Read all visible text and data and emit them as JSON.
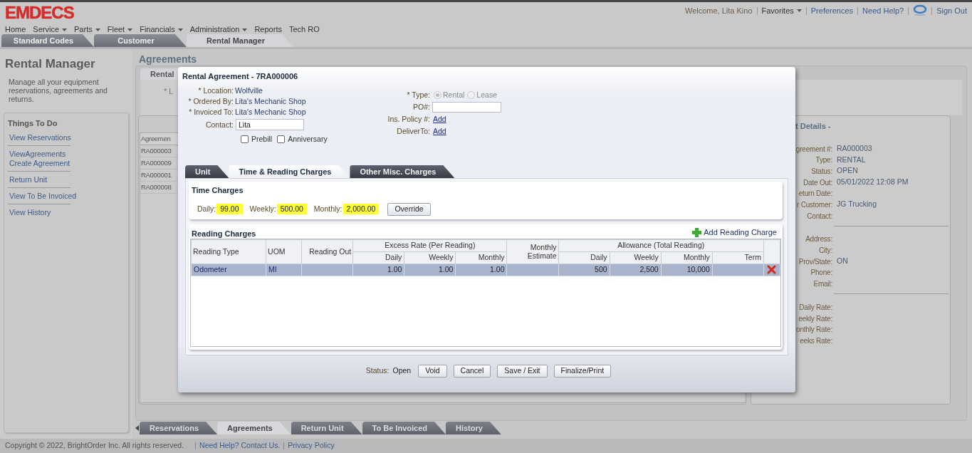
{
  "header": {
    "logo": "EMDECS",
    "nav": [
      {
        "label": "Home",
        "dropdown": false
      },
      {
        "label": "Service",
        "dropdown": true
      },
      {
        "label": "Parts",
        "dropdown": true
      },
      {
        "label": "Fleet",
        "dropdown": true
      },
      {
        "label": "Financials",
        "dropdown": true
      },
      {
        "label": "Administration",
        "dropdown": true
      },
      {
        "label": "Reports",
        "dropdown": false
      },
      {
        "label": "Tech RO",
        "dropdown": false
      }
    ],
    "user_links": [
      {
        "kind": "text",
        "label": "Welcome, Lita Kino"
      },
      {
        "kind": "menu",
        "label": "Favorites"
      },
      {
        "kind": "link",
        "label": "Preferences"
      },
      {
        "kind": "link",
        "label": "Need Help?"
      },
      {
        "kind": "icon"
      },
      {
        "kind": "link",
        "label": "Sign Out"
      }
    ]
  },
  "top_tabs": [
    {
      "label": "Standard Codes",
      "selected": false
    },
    {
      "label": "Customer",
      "selected": false
    },
    {
      "label": "Rental Manager",
      "selected": true
    }
  ],
  "sidebar": {
    "title": "Rental Manager",
    "description": "Manage all your equipment reservations, agreements and returns.",
    "section_title": "Things To Do",
    "groups": [
      {
        "items": [
          "View Reservations"
        ]
      },
      {
        "items": [
          "ViewAgreements",
          "Create Agreement"
        ]
      },
      {
        "items": [
          "Return Unit"
        ]
      },
      {
        "items": [
          "View To Be Invoiced"
        ]
      },
      {
        "items": [
          "View History"
        ]
      }
    ]
  },
  "content": {
    "title": "Agreements",
    "sub_tab": "Rental",
    "field_label": "* L",
    "list_table": {
      "column": "Agreemen",
      "rows": [
        "RA000003",
        "RA000009",
        "RA000001",
        "RA000008"
      ]
    },
    "details": {
      "title": "t Details -",
      "groups": [
        {
          "fields": [
            {
              "label": "greement #:",
              "value": "RA000003"
            },
            {
              "label": "Type:",
              "value": "RENTAL"
            },
            {
              "label": "Status:",
              "value": "OPEN"
            },
            {
              "label": "Date Out:",
              "value": "05/01/2022 12:08 PM"
            },
            {
              "label": "eturn Date:"
            },
            {
              "label": "r Customer:",
              "value": "JG Trucking"
            },
            {
              "label": "Contact:"
            }
          ]
        },
        {
          "fields": [
            {
              "label": "Address:"
            },
            {
              "label": "City:"
            },
            {
              "label": "Prov/State:",
              "value": "ON"
            },
            {
              "label": "Phone:"
            },
            {
              "label": "Email:"
            }
          ]
        },
        {
          "fields": [
            {
              "label": "Daily Rate:"
            },
            {
              "label": "eekly Rate:"
            },
            {
              "label": "onthly Rate:"
            },
            {
              "label": "eeks Rate:"
            }
          ]
        }
      ]
    }
  },
  "bottom_tabs": [
    {
      "label": "Reservations",
      "selected": false
    },
    {
      "label": "Agreements",
      "selected": true
    },
    {
      "label": "Return Unit",
      "selected": false
    },
    {
      "label": "To Be Invoiced",
      "selected": false
    },
    {
      "label": "History",
      "selected": false
    }
  ],
  "footer": {
    "copyright": "Copyright © 2022, BrightOrder Inc. All rights reserved.",
    "links": [
      "Need Help? Contact Us.",
      "Privacy Policy"
    ]
  },
  "dialog": {
    "title": "Rental Agreement - 7RA000006",
    "left_fields": [
      {
        "kind": "text",
        "label": "* Location:",
        "value": "Wolfville"
      },
      {
        "kind": "text",
        "label": "* Ordered By:",
        "value": "Lita's Mechanic Shop"
      },
      {
        "kind": "text",
        "label": "* Invoiced To:",
        "value": "Lita's Mechanic Shop"
      },
      {
        "kind": "input",
        "label": "Contact:",
        "value": "Lita"
      }
    ],
    "checkboxes": [
      {
        "label": "Prebill",
        "checked": false
      },
      {
        "label": "Anniversary",
        "checked": false
      }
    ],
    "right_fields": [
      {
        "kind": "radio",
        "label": "* Type:",
        "options": [
          {
            "label": "Rental",
            "selected": true,
            "disabled": true
          },
          {
            "label": "Lease",
            "selected": false,
            "disabled": true
          }
        ]
      },
      {
        "kind": "input",
        "label": "PO#:"
      },
      {
        "kind": "link",
        "label": "Ins. Policy #:",
        "value": "Add"
      },
      {
        "kind": "link",
        "label": "DeliverTo:",
        "value": "Add"
      }
    ],
    "tabs": [
      {
        "label": "Unit",
        "selected": false
      },
      {
        "label": "Time & Reading Charges",
        "selected": true
      },
      {
        "label": "Other Misc. Charges",
        "selected": false
      }
    ],
    "time_charges": {
      "title": "Time Charges",
      "fields": [
        {
          "label": "Daily:",
          "value": "99.00"
        },
        {
          "label": "Weekly:",
          "value": "500.00"
        },
        {
          "label": "Monthly:",
          "value": "2,000.00"
        }
      ],
      "button": "Override"
    },
    "reading_charges": {
      "title": "Reading Charges",
      "add_label": "Add Reading Charge",
      "columns": [
        {
          "label": "Reading Type"
        },
        {
          "label": "UOM"
        },
        {
          "label": "Reading Out"
        },
        {
          "label": "Excess Rate (Per Reading)",
          "colspan": 3,
          "sub": [
            "Daily",
            "Weekly",
            "Monthly"
          ]
        },
        {
          "label": "Monthly Estimate"
        },
        {
          "label": "Allowance (Total Reading)",
          "colspan": 4,
          "sub": [
            "Daily",
            "Weekly",
            "Monthly",
            "Term"
          ]
        }
      ],
      "rows": [
        {
          "selected": true,
          "cells": [
            "Odometer",
            "MI",
            "",
            "1.00",
            "1.00",
            "1.00",
            "",
            "500",
            "2,500",
            "10,000",
            ""
          ]
        }
      ]
    },
    "status_label": "Status:",
    "status_value": "Open",
    "buttons": [
      "Void",
      "Cancel",
      "Save / Exit",
      "Finalize/Print"
    ]
  }
}
